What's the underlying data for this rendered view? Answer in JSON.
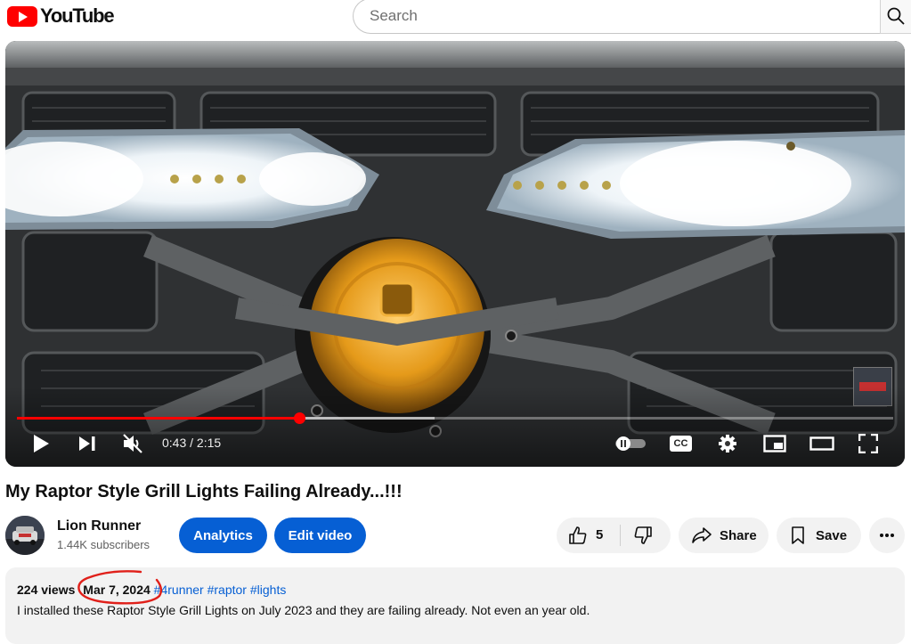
{
  "header": {
    "logo_text": "YouTube",
    "search_placeholder": "Search"
  },
  "player": {
    "current_time": "0:43",
    "separator": "/",
    "duration": "2:15",
    "progress_fraction": 0.322,
    "buffered_fraction": 0.477,
    "accent_color": "#ff0000",
    "cc_label": "CC"
  },
  "video": {
    "title": "My Raptor Style Grill Lights Failing Already...!!!",
    "channel_name": "Lion Runner",
    "subscribers": "1.44K subscribers",
    "analytics_label": "Analytics",
    "edit_label": "Edit video",
    "like_count": "5",
    "share_label": "Share",
    "save_label": "Save"
  },
  "description": {
    "views": "224 views",
    "date": "Mar 7, 2024",
    "hashtags": [
      "#4runner",
      "#raptor",
      "#lights"
    ],
    "text": "I installed these Raptor Style Grill Lights on July 2023 and they are failing already. Not even an year old."
  },
  "colors": {
    "brand_blue": "#065fd4",
    "annotation_red": "#e0201a"
  }
}
